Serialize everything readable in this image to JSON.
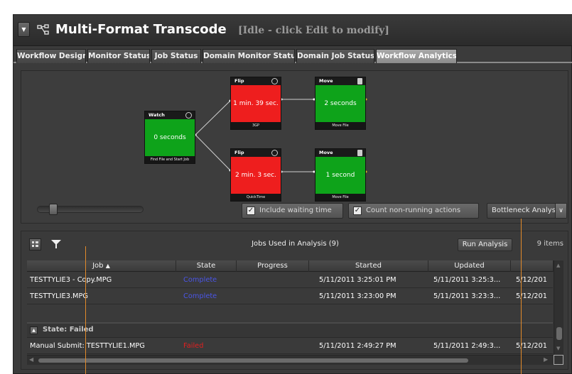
{
  "window": {
    "title": "Multi-Format Transcode",
    "status": "[Idle - click Edit to modify]"
  },
  "tabs": [
    {
      "label": "Workflow Design",
      "active": false
    },
    {
      "label": "Monitor Status",
      "active": false
    },
    {
      "label": "Job Status",
      "active": false
    },
    {
      "label": "Domain Monitor Status",
      "active": false
    },
    {
      "label": "Domain Job Status",
      "active": false
    },
    {
      "label": "Workflow Analytics",
      "active": true
    }
  ],
  "workflow": {
    "nodes": [
      {
        "title": "Watch",
        "value": "0 seconds",
        "footer": "Find File and Start Job",
        "status": "green",
        "icon": "watch-icon"
      },
      {
        "title": "Flip",
        "value": "1 min. 39 sec.",
        "footer": "3GP",
        "status": "red",
        "icon": "gear-icon"
      },
      {
        "title": "Move",
        "value": "2 seconds",
        "footer": "Move File",
        "status": "green",
        "icon": "document-icon"
      },
      {
        "title": "Flip",
        "value": "2 min. 3 sec.",
        "footer": "QuickTime",
        "status": "red",
        "icon": "gear-icon"
      },
      {
        "title": "Move",
        "value": "1 second",
        "footer": "Move File",
        "status": "green",
        "icon": "document-icon"
      }
    ],
    "options": {
      "include_waiting": {
        "label": "Include waiting time",
        "checked": true
      },
      "count_non_running": {
        "label": "Count non-running actions",
        "checked": true
      },
      "analysis_mode": "Bottleneck Analysis"
    }
  },
  "jobs_panel": {
    "title": "Jobs Used in Analysis (9)",
    "run_button": "Run Analysis",
    "item_count": "9 items",
    "columns": [
      "Job",
      "State",
      "Progress",
      "Started",
      "Updated",
      ""
    ],
    "rows": [
      {
        "job": "TESTTYLIE3 - Copy.MPG",
        "state": "Complete",
        "progress": "",
        "started": "5/11/2011 3:25:01 PM",
        "updated": "5/11/2011 3:25:3...",
        "extra": "5/12/201"
      },
      {
        "job": "TESTTYLIE3.MPG",
        "state": "Complete",
        "progress": "",
        "started": "5/11/2011 3:23:00 PM",
        "updated": "5/11/2011 3:23:3...",
        "extra": "5/12/201"
      }
    ],
    "group": {
      "label": "State: Failed"
    },
    "failed_rows": [
      {
        "job": "Manual Submit: TESTTYLIE1.MPG",
        "state": "Failed",
        "progress": "",
        "started": "5/11/2011 2:49:27 PM",
        "updated": "5/11/2011 2:49:3...",
        "extra": "5/12/201"
      }
    ]
  },
  "colors": {
    "complete": "#4a55e6",
    "failed": "#e02020",
    "node_red": "#ee1e1e",
    "node_green": "#0ea31a",
    "pointer": "#e28a2a"
  }
}
